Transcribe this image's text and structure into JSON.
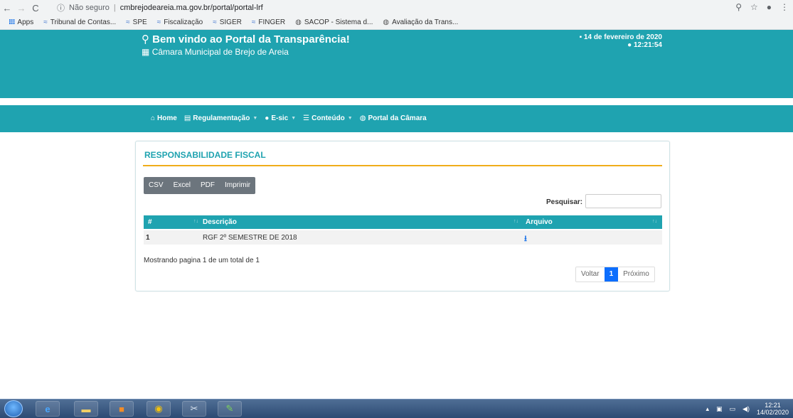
{
  "browser": {
    "security_label": "Não seguro",
    "url": "cmbrejodeareia.ma.gov.br/portal/portal-lrf",
    "bookmarks": [
      {
        "label": "Apps",
        "icon": "apps-grid-icon"
      },
      {
        "label": "Tribunal de Contas...",
        "icon": "tcu-logo-icon"
      },
      {
        "label": "SPE",
        "icon": "tcu-logo-icon"
      },
      {
        "label": "Fiscalização",
        "icon": "tcu-logo-icon"
      },
      {
        "label": "SIGER",
        "icon": "tcu-logo-icon"
      },
      {
        "label": "FINGER",
        "icon": "tcu-logo-icon"
      },
      {
        "label": "SACOP - Sistema d...",
        "icon": "globe-icon"
      },
      {
        "label": "Avaliação da Trans...",
        "icon": "globe-icon"
      }
    ]
  },
  "header": {
    "title": "Bem vindo ao Portal da Transparência!",
    "subtitle": "Câmara Municipal de Brejo de Areia",
    "date": "14 de fevereiro de 2020",
    "time": "12:21:54"
  },
  "menu": [
    {
      "label": "Home",
      "icon": "home-icon",
      "caret": false
    },
    {
      "label": "Regulamentação",
      "icon": "document-icon",
      "caret": true
    },
    {
      "label": "E-sic",
      "icon": "info-icon",
      "caret": true
    },
    {
      "label": "Conteúdo",
      "icon": "list-icon",
      "caret": true
    },
    {
      "label": "Portal da Câmara",
      "icon": "globe-icon",
      "caret": false
    }
  ],
  "panel": {
    "title": "RESPONSABILIDADE FISCAL",
    "export_buttons": [
      "CSV",
      "Excel",
      "PDF",
      "Imprimir"
    ],
    "search_label": "Pesquisar:",
    "search_value": "",
    "columns": [
      "#",
      "Descrição",
      "Arquivo"
    ],
    "rows": [
      {
        "num": "1",
        "descricao": "RGF 2º SEMESTRE DE 2018"
      }
    ],
    "info": "Mostrando pagina 1 de um total de 1",
    "pager": {
      "prev": "Voltar",
      "current": "1",
      "next": "Próximo"
    }
  },
  "taskbar": {
    "clock_time": "12:21",
    "clock_date": "14/02/2020"
  },
  "colors": {
    "brand": "#1fa3b0",
    "accent_rule": "#f0ad1b",
    "pager_active": "#0d6efd"
  }
}
